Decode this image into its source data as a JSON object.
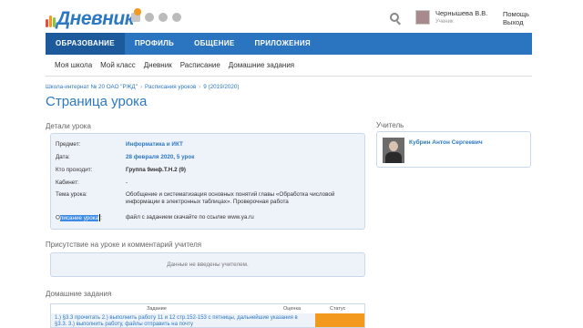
{
  "app": {
    "logo_text": "Дневник",
    "notification_count": ""
  },
  "user": {
    "name": "Чернышева В.В.",
    "role": "Ученик"
  },
  "help": "Помощь Выход",
  "main_nav": [
    {
      "label": "ОБРАЗОВАНИЕ",
      "active": true
    },
    {
      "label": "ПРОФИЛЬ",
      "active": false
    },
    {
      "label": "ОБЩЕНИЕ",
      "active": false
    },
    {
      "label": "ПРИЛОЖЕНИЯ",
      "active": false
    }
  ],
  "sub_nav": [
    "Моя школа",
    "Мой класс",
    "Дневник",
    "Расписание",
    "Домашние задания"
  ],
  "breadcrumb": [
    "Школа-интернат № 20 ОАО \"РЖД\"",
    "Расписания уроков",
    "9 (2019/2020)"
  ],
  "page_title": "Страница урока",
  "details": {
    "title": "Детали урока",
    "rows": [
      {
        "label": "Предмет:",
        "value": "Информатика и ИКТ"
      },
      {
        "label": "Дата:",
        "value": "28 февраля 2020, 5 урок"
      },
      {
        "label": "Кто проходит:",
        "value": "Группа 9инф.Т.Н.2 (9)"
      },
      {
        "label": "Кабинет:",
        "value": "-"
      },
      {
        "label": "Тема урока:",
        "value": "Обобщение и систематизация основных понятий главы «Обработка числовой информации в электронных таблицах». Проверочная работа"
      },
      {
        "label_prefix": "О",
        "label_highlight": "писание урока",
        "label_suffix": ":",
        "value": "файл с заданием скачайте по ссылке www.ya.ru"
      }
    ]
  },
  "teacher": {
    "title": "Учитель",
    "name": "Кубрин Антон Сергеевич"
  },
  "attendance": {
    "title": "Присутствие на уроке и комментарий учителя",
    "empty_text": "Данные не введены учителем."
  },
  "homework": {
    "title": "Домашние задания",
    "columns": [
      "Задание",
      "Оценка",
      "Статус"
    ],
    "rows": [
      {
        "task": "1.) §3.3 прочитать 2.) выполнить работу 11 и 12 стр.152-153 с пятницы, дальнейшие указания в §3.3. 3.) выполнить работу, файлы отправить на почту",
        "status_color": "#f39a1e"
      }
    ]
  },
  "colors": {
    "brand": "#2c78c3",
    "nav_bg": "#2b74bf",
    "nav_active": "#1c5a9b",
    "box_bg": "#eef3fa",
    "status_pending": "#f39a1e"
  }
}
